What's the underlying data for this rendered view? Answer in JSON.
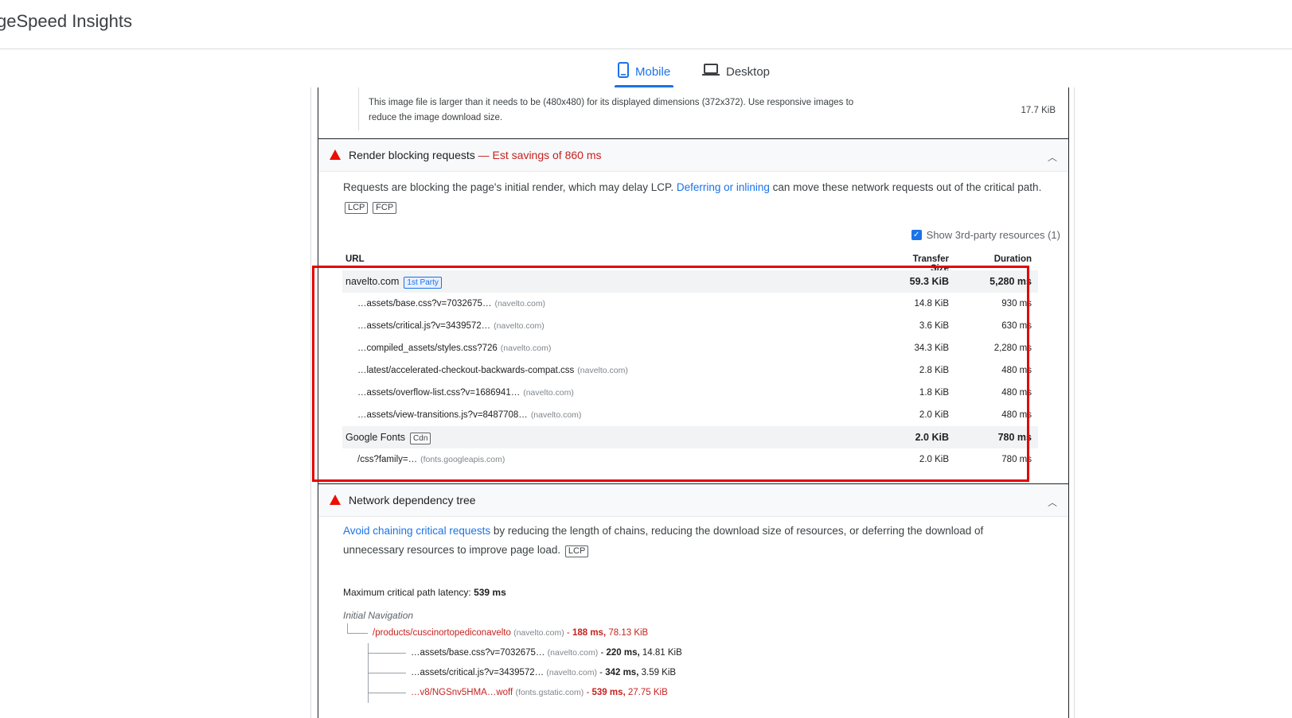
{
  "app": {
    "title": "geSpeed Insights"
  },
  "tabs": [
    {
      "label": "Mobile",
      "icon": "phone-icon",
      "active": true
    },
    {
      "label": "Desktop",
      "icon": "laptop-icon",
      "active": false
    }
  ],
  "image_note": {
    "text": "This image file is larger than it needs to be (480x480) for its displayed dimensions (372x372). Use responsive images to reduce the image download size.",
    "size": "17.7 KiB"
  },
  "render_blocking": {
    "title": "Render blocking requests",
    "savings": "— Est savings of 860 ms",
    "desc_before": "Requests are blocking the page's initial render, which may delay LCP. ",
    "desc_link": "Deferring or inlining",
    "desc_after": " can move these network requests out of the critical path.",
    "chips": [
      "LCP",
      "FCP"
    ],
    "show_third_party": "Show 3rd-party resources (1)",
    "columns": {
      "url": "URL",
      "size": "Transfer Size",
      "duration": "Duration"
    },
    "rows": [
      {
        "type": "group",
        "url": "navelto.com",
        "badge": "1st Party",
        "size": "59.3 KiB",
        "duration": "5,280 ms"
      },
      {
        "type": "sub",
        "url": "…assets/base.css?v=7032675…",
        "host": "(navelto.com)",
        "size": "14.8 KiB",
        "duration": "930 ms"
      },
      {
        "type": "sub",
        "url": "…assets/critical.js?v=3439572…",
        "host": "(navelto.com)",
        "size": "3.6 KiB",
        "duration": "630 ms"
      },
      {
        "type": "sub",
        "url": "…compiled_assets/styles.css?726",
        "host": "(navelto.com)",
        "size": "34.3 KiB",
        "duration": "2,280 ms"
      },
      {
        "type": "sub",
        "url": "…latest/accelerated-checkout-backwards-compat.css",
        "host": "(navelto.com)",
        "size": "2.8 KiB",
        "duration": "480 ms"
      },
      {
        "type": "sub",
        "url": "…assets/overflow-list.css?v=1686941…",
        "host": "(navelto.com)",
        "size": "1.8 KiB",
        "duration": "480 ms"
      },
      {
        "type": "sub",
        "url": "…assets/view-transitions.js?v=8487708…",
        "host": "(navelto.com)",
        "size": "2.0 KiB",
        "duration": "480 ms"
      },
      {
        "type": "group",
        "url": "Google Fonts",
        "badge": "Cdn",
        "size": "2.0 KiB",
        "duration": "780 ms"
      },
      {
        "type": "sub",
        "url": "/css?family=…",
        "host": "(fonts.googleapis.com)",
        "size": "2.0 KiB",
        "duration": "780 ms"
      }
    ]
  },
  "network_tree": {
    "title": "Network dependency tree",
    "desc_link": "Avoid chaining critical requests",
    "desc_after": " by reducing the length of chains, reducing the download size of resources, or deferring the download of unnecessary resources to improve page load.",
    "chip": "LCP",
    "latency_label": "Maximum critical path latency: ",
    "latency_value": "539 ms",
    "nav_label": "Initial Navigation",
    "items": [
      {
        "path": "/products/cuscinortopediconavelto",
        "host": "(navelto.com)",
        "time": "188 ms,",
        "size": "78.13 KiB",
        "red": true
      },
      {
        "path": "…assets/base.css?v=7032675…",
        "host": "(navelto.com)",
        "time": "220 ms,",
        "size": "14.81 KiB",
        "red": false
      },
      {
        "path": "…assets/critical.js?v=3439572…",
        "host": "(navelto.com)",
        "time": "342 ms,",
        "size": "3.59 KiB",
        "red": false
      },
      {
        "path": "…v8/NGSnv5HMA…woff",
        "host": "(fonts.gstatic.com)",
        "time": "539 ms,",
        "size": "27.75 KiB",
        "red": true
      }
    ]
  }
}
